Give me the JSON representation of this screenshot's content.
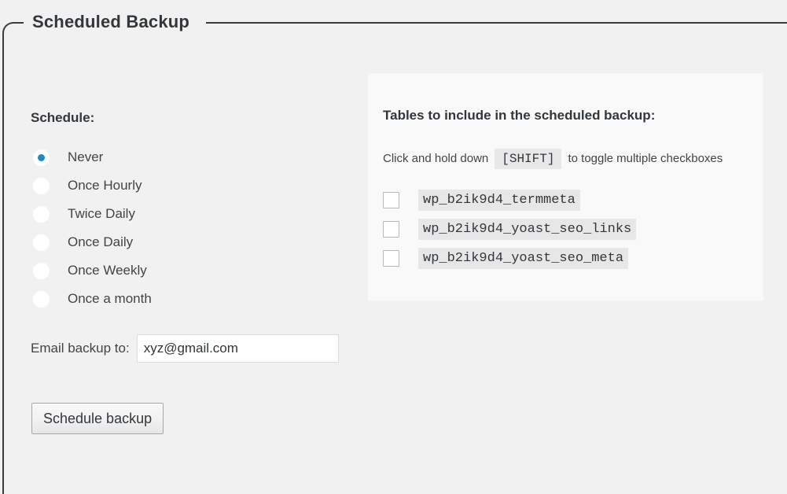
{
  "panel": {
    "legend": "Scheduled Backup"
  },
  "schedule": {
    "label": "Schedule:",
    "selected": "Never",
    "options": [
      {
        "label": "Never",
        "checked": true
      },
      {
        "label": "Once Hourly",
        "checked": false
      },
      {
        "label": "Twice Daily",
        "checked": false
      },
      {
        "label": "Once Daily",
        "checked": false
      },
      {
        "label": "Once Weekly",
        "checked": false
      },
      {
        "label": "Once a month",
        "checked": false
      }
    ]
  },
  "email": {
    "label": "Email backup to:",
    "value": "xyz@gmail.com",
    "placeholder": ""
  },
  "submit": {
    "label": "Schedule backup"
  },
  "tables": {
    "title": "Tables to include in the scheduled backup:",
    "hint_prefix": "Click and hold down",
    "hint_key": "[SHIFT]",
    "hint_suffix": "to toggle multiple checkboxes",
    "items": [
      {
        "name": "wp_b2ik9d4_termmeta",
        "checked": false
      },
      {
        "name": "wp_b2ik9d4_yoast_seo_links",
        "checked": false
      },
      {
        "name": "wp_b2ik9d4_yoast_seo_meta",
        "checked": false
      }
    ]
  },
  "colors": {
    "page_background": "#f1f1f1",
    "panel_background": "#f9f9f9",
    "border": "#3c3c3c",
    "accent": "#1e8cbe",
    "text": "#32373c",
    "chip_background": "#e7e7e7",
    "kbd_background": "#e8e8e8",
    "checkbox_border": "#b4b9be"
  }
}
